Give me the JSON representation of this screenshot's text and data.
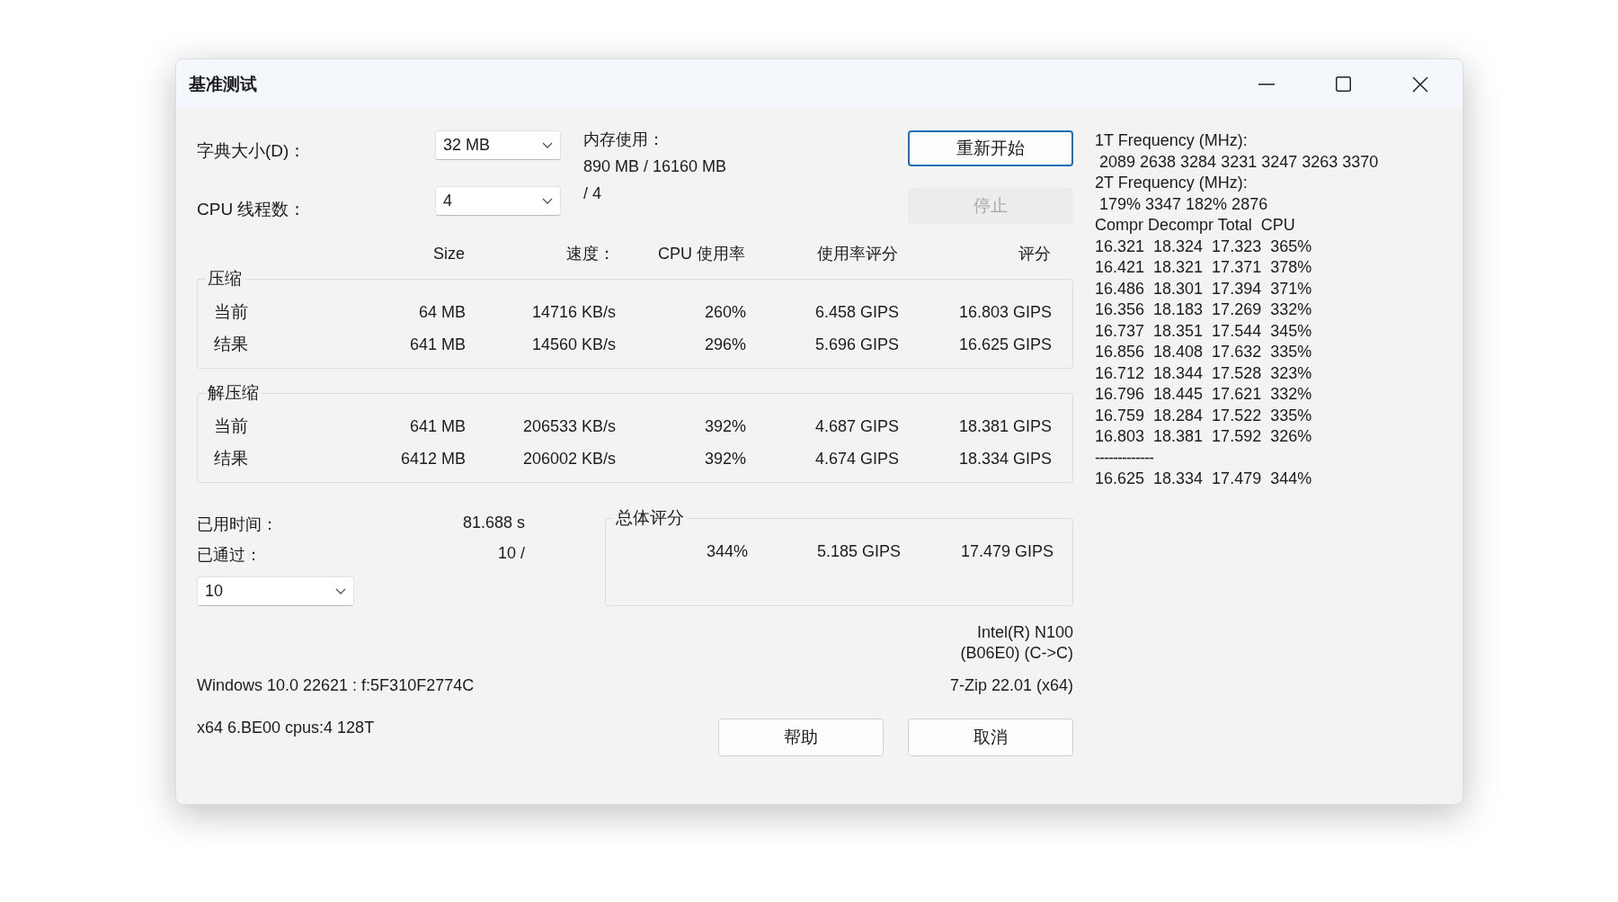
{
  "window": {
    "title": "基准测试"
  },
  "dictionary": {
    "label": "字典大小(D)：",
    "value": "32 MB"
  },
  "memory": {
    "label": "内存使用：",
    "value": "890 MB / 16160 MB"
  },
  "threads": {
    "label": "CPU 线程数：",
    "value": "4",
    "max": "/ 4"
  },
  "action_buttons": [
    {
      "label": "重新开始",
      "disabled": false,
      "focused": true
    },
    {
      "label": "停止",
      "disabled": true,
      "focused": false
    }
  ],
  "columns": [
    "Size",
    "速度：",
    "CPU 使用率",
    "使用率评分",
    "评分"
  ],
  "groups": [
    {
      "title": "压缩",
      "rows": [
        {
          "label": "当前",
          "cells": [
            "64 MB",
            "14716 KB/s",
            "260%",
            "6.458 GIPS",
            "16.803 GIPS"
          ]
        },
        {
          "label": "结果",
          "cells": [
            "641 MB",
            "14560 KB/s",
            "296%",
            "5.696 GIPS",
            "16.625 GIPS"
          ]
        }
      ]
    },
    {
      "title": "解压缩",
      "rows": [
        {
          "label": "当前",
          "cells": [
            "641 MB",
            "206533 KB/s",
            "392%",
            "4.687 GIPS",
            "18.381 GIPS"
          ]
        },
        {
          "label": "结果",
          "cells": [
            "6412 MB",
            "206002 KB/s",
            "392%",
            "4.674 GIPS",
            "18.334 GIPS"
          ]
        }
      ]
    }
  ],
  "elapsed": {
    "label": "已用时间：",
    "value": "81.688 s"
  },
  "passes": {
    "label": "已通过：",
    "value": "10 /",
    "select": "10"
  },
  "total": {
    "title": "总体评分",
    "cells": [
      "344%",
      "5.185 GIPS",
      "17.479 GIPS"
    ]
  },
  "cpu_info": [
    "Intel(R) N100",
    "(B06E0) (C->C)"
  ],
  "system": "Windows 10.0 22621 : f:5F310F2774C",
  "version": "7-Zip 22.01 (x64)",
  "arch": "x64 6.BE00 cpus:4 128T",
  "bottom_buttons": [
    "帮助",
    "取消"
  ],
  "log": [
    {
      "kind": "heading",
      "text": "1T Frequency (MHz):"
    },
    {
      "kind": "values",
      "text": "2089 2638 3284 3231 3247 3263 3370"
    },
    {
      "kind": "heading",
      "text": "2T Frequency (MHz):"
    },
    {
      "kind": "values",
      "text": "179% 3347 182% 2876"
    },
    {
      "kind": "heading",
      "text": "Compr Decompr Total  CPU"
    },
    {
      "kind": "heading",
      "text": "16.321  18.324  17.323  365%"
    },
    {
      "kind": "heading",
      "text": "16.421  18.321  17.371  378%"
    },
    {
      "kind": "heading",
      "text": "16.486  18.301  17.394  371%"
    },
    {
      "kind": "heading",
      "text": "16.356  18.183  17.269  332%"
    },
    {
      "kind": "heading",
      "text": "16.737  18.351  17.544  345%"
    },
    {
      "kind": "heading",
      "text": "16.856  18.408  17.632  335%"
    },
    {
      "kind": "heading",
      "text": "16.712  18.344  17.528  323%"
    },
    {
      "kind": "heading",
      "text": "16.796  18.445  17.621  332%"
    },
    {
      "kind": "heading",
      "text": "16.759  18.284  17.522  335%"
    },
    {
      "kind": "heading",
      "text": "16.803  18.381  17.592  326%"
    },
    {
      "kind": "separator",
      "text": "-------------"
    },
    {
      "kind": "heading",
      "text": "16.625  18.334  17.479  344%"
    }
  ]
}
